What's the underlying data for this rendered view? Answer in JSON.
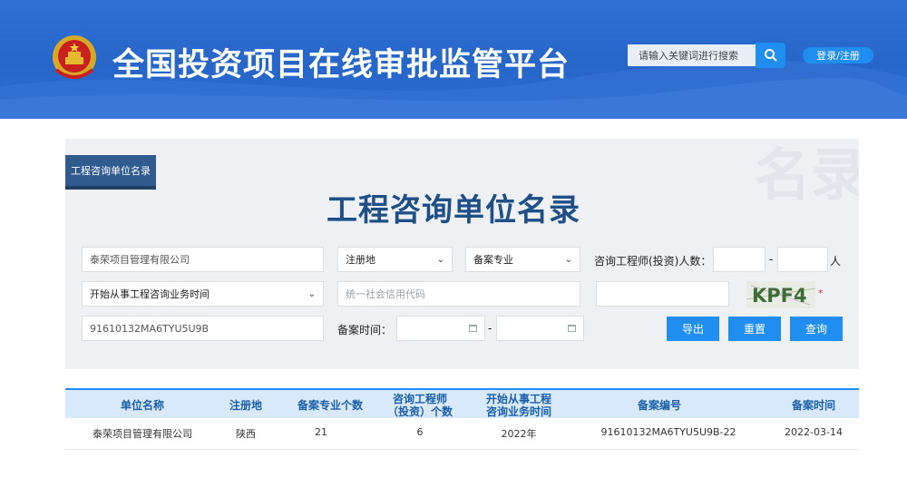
{
  "header": {
    "site_title": "全国投资项目在线审批监管平台",
    "search_placeholder": "请输入关键词进行搜索",
    "login_label": "登录/注册",
    "colors": {
      "header_blue": "#2766c9",
      "accent": "#1f8ef0"
    }
  },
  "panel": {
    "tag_label": "工程咨询单位名录",
    "title": "工程咨询单位名录",
    "watermark": "名录查询",
    "form": {
      "unit_name_value": "泰荣项目管理有限公司",
      "reg_place_select": "注册地",
      "specialty_select": "备案专业",
      "engineer_count_label": "咨询工程师(投资)人数：",
      "range_dash": "-",
      "people_unit": "人",
      "start_time_select": "开始从事工程咨询业务时间",
      "credit_code_placeholder": "统一社会信用代码",
      "captcha_text": "KPF4",
      "captcha_required": "*",
      "filing_no_value": "91610132MA6TYU5U9B",
      "filing_time_label": "备案时间：",
      "date_dash": "-"
    },
    "buttons": {
      "export": "导出",
      "reset": "重置",
      "query": "查询"
    }
  },
  "table": {
    "headers": [
      "单位名称",
      "注册地",
      "备案专业个数",
      "咨询工程师\n（投资）个数",
      "开始从事工程\n咨询业务时间",
      "备案编号",
      "备案时间"
    ],
    "rows": [
      [
        "泰荣项目管理有限公司",
        "陕西",
        "21",
        "6",
        "2022年",
        "91610132MA6TYU5U9B-22",
        "2022-03-14"
      ]
    ]
  }
}
